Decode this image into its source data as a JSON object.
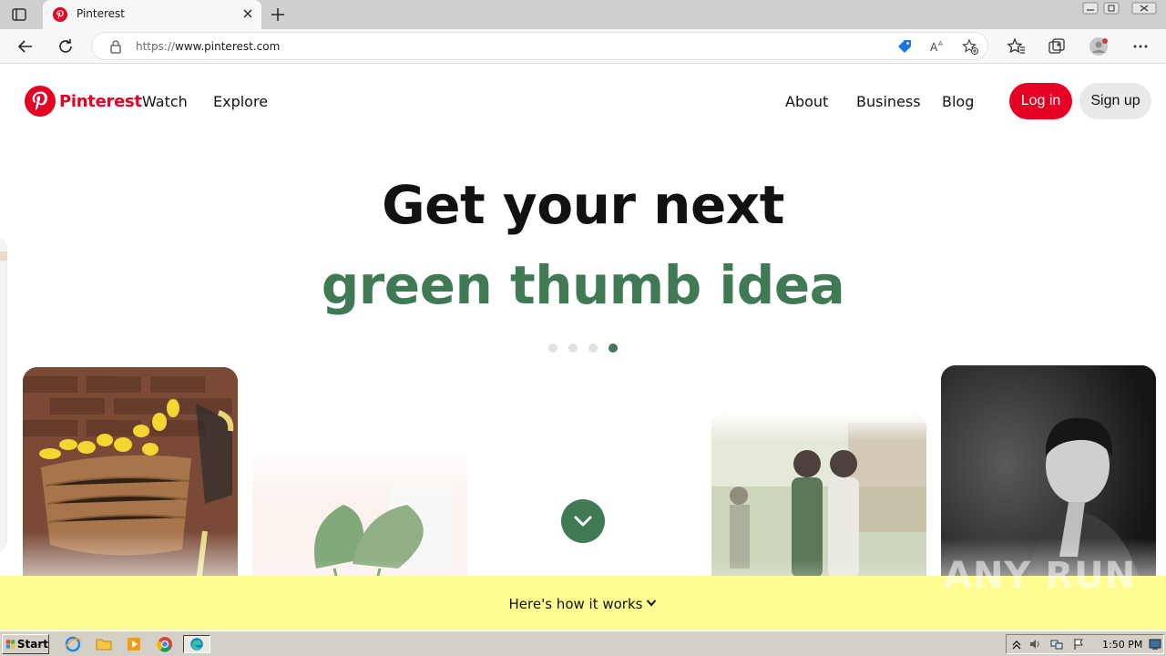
{
  "browser": {
    "tab_title": "Pinterest",
    "url_prefix": "https://",
    "url_host": "www.pinterest.com"
  },
  "header": {
    "logo_text": "Pinterest",
    "nav": [
      "Watch",
      "Explore"
    ],
    "right_links": [
      "About",
      "Business",
      "Blog"
    ],
    "login_label": "Log in",
    "signup_label": "Sign up"
  },
  "hero": {
    "headline": "Get your next",
    "subline": "green thumb idea",
    "carousel_total": 4,
    "carousel_active": 4
  },
  "footer_bar": {
    "how_label": "Here's how it works"
  },
  "watermark": "ANY RUN",
  "taskbar": {
    "start_label": "Start",
    "clock": "1:50 PM"
  },
  "colors": {
    "brand": "#e60023",
    "accent_green": "#3f7a55",
    "how_bar": "#fffd92"
  },
  "icons": [
    "tab-sidebar-icon",
    "pinterest-favicon",
    "close-icon",
    "plus-icon",
    "back-icon",
    "refresh-icon",
    "lock-icon",
    "shopping-tag-icon",
    "read-aloud-icon",
    "add-favorite-icon",
    "favorites-icon",
    "collections-icon",
    "profile-icon",
    "more-icon",
    "chevron-down-icon"
  ]
}
